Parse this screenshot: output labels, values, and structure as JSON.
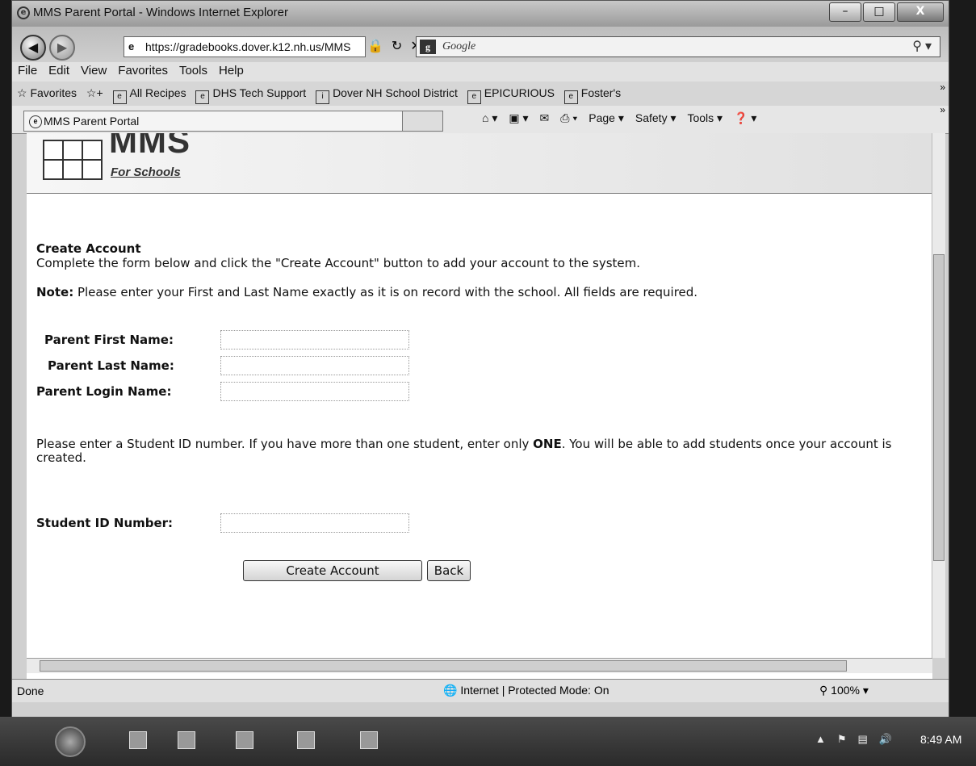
{
  "window": {
    "title": "MMS Parent Portal - Windows Internet Explorer",
    "buttons": {
      "minimize": "–",
      "maximize": "□",
      "close": "X"
    }
  },
  "address_bar": {
    "url": "https://gradebooks.dover.k12.nh.us/MMS",
    "search_placeholder": "Google"
  },
  "menu": [
    "File",
    "Edit",
    "View",
    "Favorites",
    "Tools",
    "Help"
  ],
  "favorites_bar": {
    "label": "Favorites",
    "items": [
      "All Recipes",
      "DHS Tech Support",
      "Dover NH School District",
      "EPICURIOUS",
      "Foster's"
    ]
  },
  "tab": {
    "title": "MMS Parent Portal"
  },
  "command_bar": {
    "page": "Page ▾",
    "safety": "Safety ▾",
    "tools": "Tools ▾"
  },
  "banner": {
    "logo_main": "MMS",
    "logo_sub": "For Schools"
  },
  "form": {
    "heading": "Create Account",
    "description": "Complete the form below and click the \"Create Account\" button to add your account to the system.",
    "note_label": "Note:",
    "note_text": " Please enter your First and Last Name exactly as it is on record with the school. All fields are required.",
    "fields": {
      "first_name": "Parent First Name:",
      "last_name": "Parent Last Name:",
      "login_name": "Parent Login Name:"
    },
    "student_para_1": "Please enter a Student ID number. If you have more than one student, enter only ",
    "student_para_one": "ONE",
    "student_para_2": ". You will be able to add students once your account is created.",
    "student_id_label": "Student ID Number:",
    "create_button": "Create Account",
    "back_button": "Back"
  },
  "status_bar": {
    "left": "Done",
    "zone": "Internet | Protected Mode: On",
    "zoom": "100%"
  },
  "taskbar": {
    "time": "8:49 AM"
  }
}
